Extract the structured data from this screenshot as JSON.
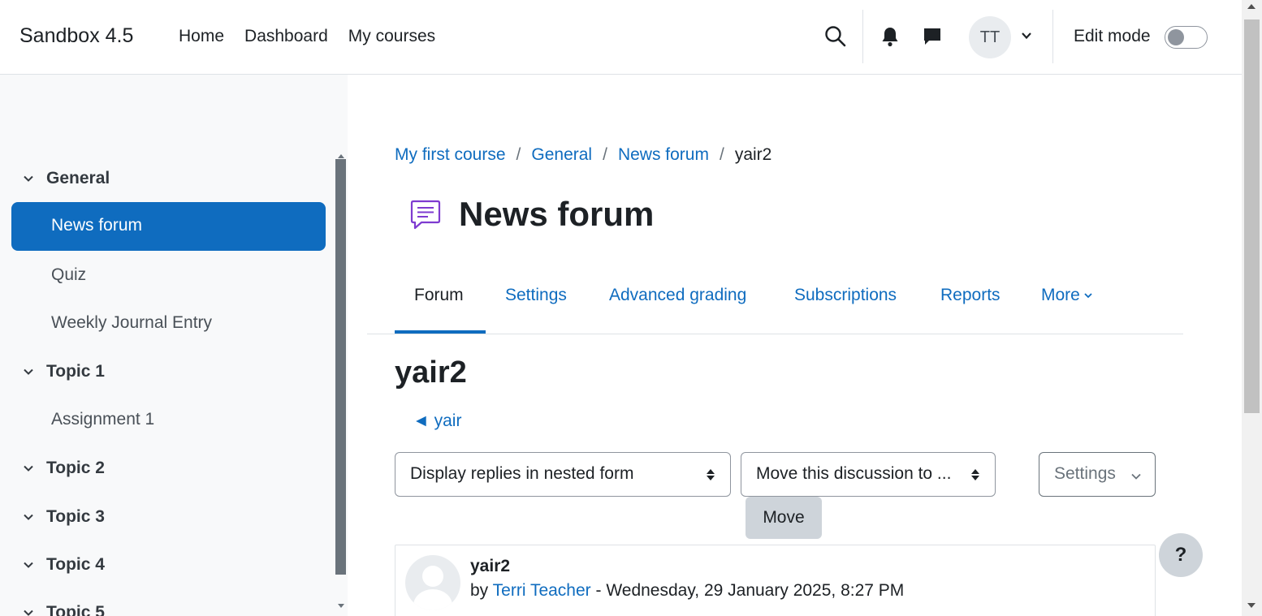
{
  "navbar": {
    "brand": "Sandbox 4.5",
    "links": [
      "Home",
      "Dashboard",
      "My courses"
    ],
    "avatar_initials": "TT",
    "edit_mode_label": "Edit mode",
    "edit_mode_on": false
  },
  "course_index": {
    "sections": [
      {
        "title": "General",
        "expanded": true
      },
      {
        "title": "Topic 1",
        "expanded": true
      },
      {
        "title": "Topic 2",
        "expanded": true
      },
      {
        "title": "Topic 3",
        "expanded": true
      },
      {
        "title": "Topic 4",
        "expanded": true
      },
      {
        "title": "Topic 5",
        "expanded": true
      }
    ],
    "activities": {
      "news_forum": "News forum",
      "quiz": "Quiz",
      "weekly_journal": "Weekly Journal Entry",
      "assignment1": "Assignment 1"
    },
    "active_activity": "News forum"
  },
  "breadcrumb": {
    "items": [
      "My first course",
      "General",
      "News forum"
    ],
    "current": "yair2"
  },
  "page": {
    "title": "News forum",
    "icon": "forum-icon"
  },
  "tabs": {
    "items": [
      "Forum",
      "Settings",
      "Advanced grading",
      "Subscriptions",
      "Reports",
      "More"
    ],
    "active": "Forum"
  },
  "discussion": {
    "title": "yair2",
    "prev_link": "◄ yair",
    "display_mode": "Display replies in nested form",
    "move_placeholder": "Move this discussion to ...",
    "move_button": "Move",
    "settings_button": "Settings"
  },
  "post": {
    "subject": "yair2",
    "by_prefix": "by",
    "author": "Terri Teacher",
    "date": "- Wednesday, 29 January 2025, 8:27 PM"
  },
  "help_button": "?",
  "colors": {
    "primary": "#0f6cbf",
    "drawer_bg": "#f8f9fa",
    "text": "#1d2125",
    "forum_icon": "#7e3bd0"
  }
}
